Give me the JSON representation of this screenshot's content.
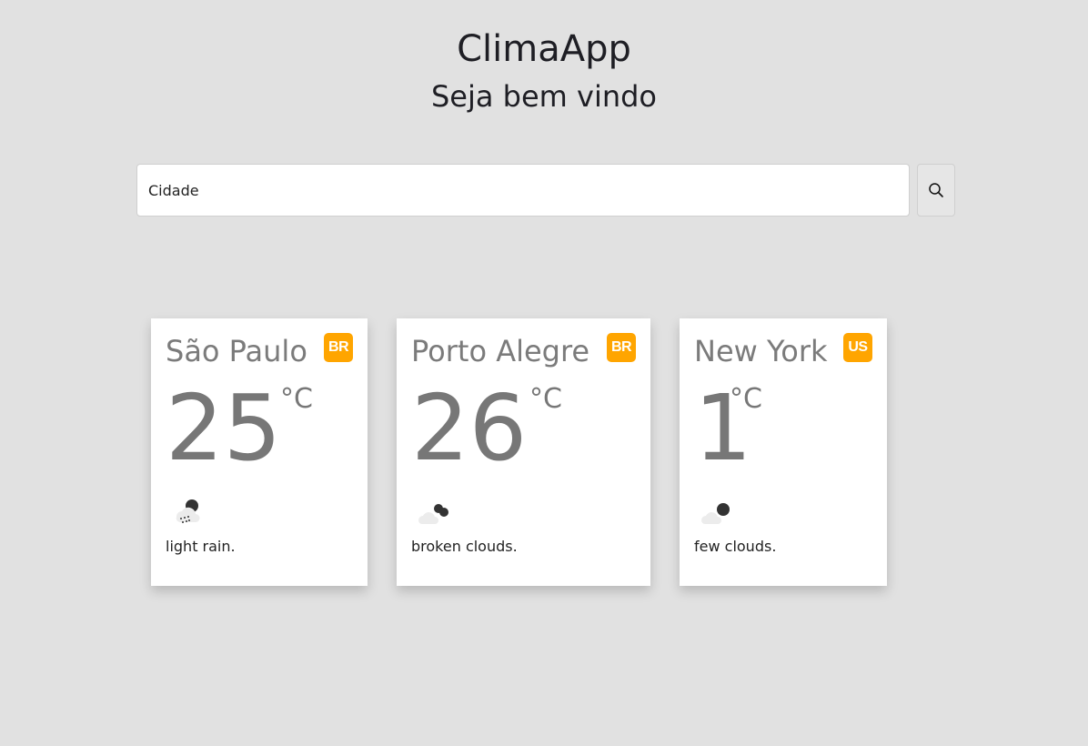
{
  "header": {
    "title": "ClimaApp",
    "subtitle": "Seja bem vindo"
  },
  "search": {
    "placeholder": "Cidade",
    "button_icon": "search-icon"
  },
  "cards": [
    {
      "city": "São Paulo",
      "country": "BR",
      "temp": "25",
      "unit": "°C",
      "icon": "light-rain-icon",
      "description": "light rain."
    },
    {
      "city": "Porto Alegre",
      "country": "BR",
      "temp": "26",
      "unit": "°C",
      "icon": "broken-clouds-icon",
      "description": "broken clouds."
    },
    {
      "city": "New York",
      "country": "US",
      "temp": "1",
      "unit": "°C",
      "icon": "few-clouds-icon",
      "description": "few clouds."
    }
  ],
  "colors": {
    "background": "#e1e1e1",
    "badge": "#ffa500",
    "card": "#ffffff",
    "muted_text": "#7b7b7b"
  }
}
